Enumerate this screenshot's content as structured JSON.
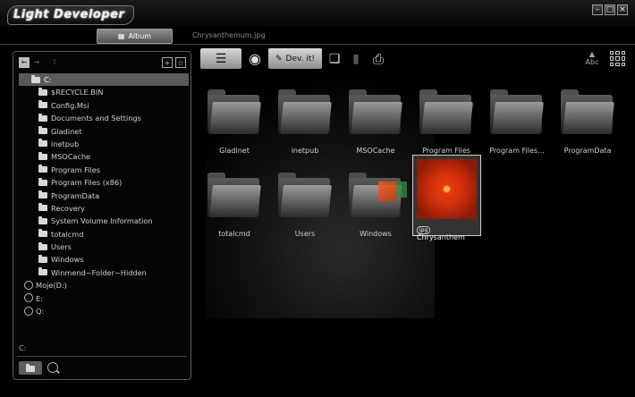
{
  "app": {
    "title": "Light Developer"
  },
  "window_controls": [
    "minimize",
    "maximize",
    "close"
  ],
  "tabs": [
    {
      "label": "Album",
      "active": true
    },
    {
      "label": "Chrysanthemum.jpg",
      "active": false
    }
  ],
  "nav": {
    "back": "back",
    "forward": "forward",
    "up": "up"
  },
  "tree": {
    "root": "C:",
    "items": [
      "$RECYCLE.BIN",
      "Config.Msi",
      "Documents and Settings",
      "Gladinet",
      "inetpub",
      "MSOCache",
      "Program Files",
      "Program Files (x86)",
      "ProgramData",
      "Recovery",
      "System Volume Information",
      "totalcmd",
      "Users",
      "Windows",
      "Winmend~Folder~Hidden"
    ],
    "drives": [
      "Moje(D:)",
      "E:",
      "Q:"
    ]
  },
  "status": {
    "path": "C:"
  },
  "toolbar": {
    "devit_label": "Dev. it!"
  },
  "sort": {
    "label": "Abc"
  },
  "gallery": {
    "items": [
      {
        "label": "Gladinet",
        "type": "folder"
      },
      {
        "label": "inetpub",
        "type": "folder"
      },
      {
        "label": "MSOCache",
        "type": "folder"
      },
      {
        "label": "Program Files",
        "type": "folder"
      },
      {
        "label": "Program Files...",
        "type": "folder"
      },
      {
        "label": "ProgramData",
        "type": "folder"
      },
      {
        "label": "totalcmd",
        "type": "folder"
      },
      {
        "label": "Users",
        "type": "folder"
      },
      {
        "label": "Windows",
        "type": "folder"
      },
      {
        "label": "Chrysanthem",
        "type": "image",
        "badge": "jpg"
      }
    ]
  },
  "colors": {
    "accent": "#5a5a5a",
    "background": "#000000",
    "image_red": "#e83a10"
  }
}
